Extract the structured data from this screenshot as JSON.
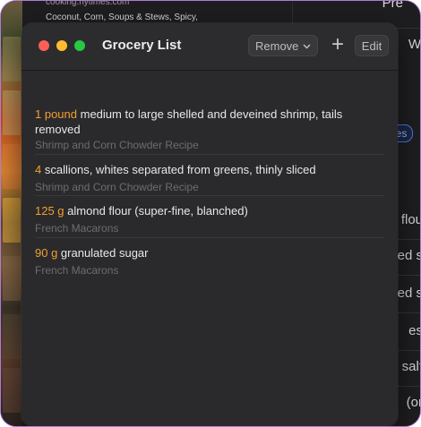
{
  "background": {
    "url": "cooking.nytimes.com",
    "breadcrumb": "Coconut, Corn, Soups & Stews, Spicy,",
    "right_items": [
      "Pre",
      "W",
      "flou",
      "ed s",
      "ed s",
      "es",
      "salt",
      "(or"
    ],
    "pill": "es"
  },
  "window": {
    "title": "Grocery List",
    "remove_label": "Remove",
    "add_label": "+",
    "edit_label": "Edit"
  },
  "items": [
    {
      "qty": "1 pound",
      "text": " medium to large shelled and deveined shrimp, tails removed",
      "source": "Shrimp and Corn Chowder Recipe"
    },
    {
      "qty": "4",
      "text": " scallions, whites separated from greens, thinly sliced",
      "source": "Shrimp and Corn Chowder Recipe"
    },
    {
      "qty": "125 g",
      "text": " almond flour (super-fine, blanched)",
      "source": "French Macarons"
    },
    {
      "qty": "90 g",
      "text": " granulated sugar",
      "source": "French Macarons"
    }
  ],
  "colors": {
    "accent_quantity": "#f0a030",
    "window_bg": "#2a2a2c",
    "close": "#ff5f57",
    "minimize": "#febc2e",
    "maximize": "#28c840"
  }
}
